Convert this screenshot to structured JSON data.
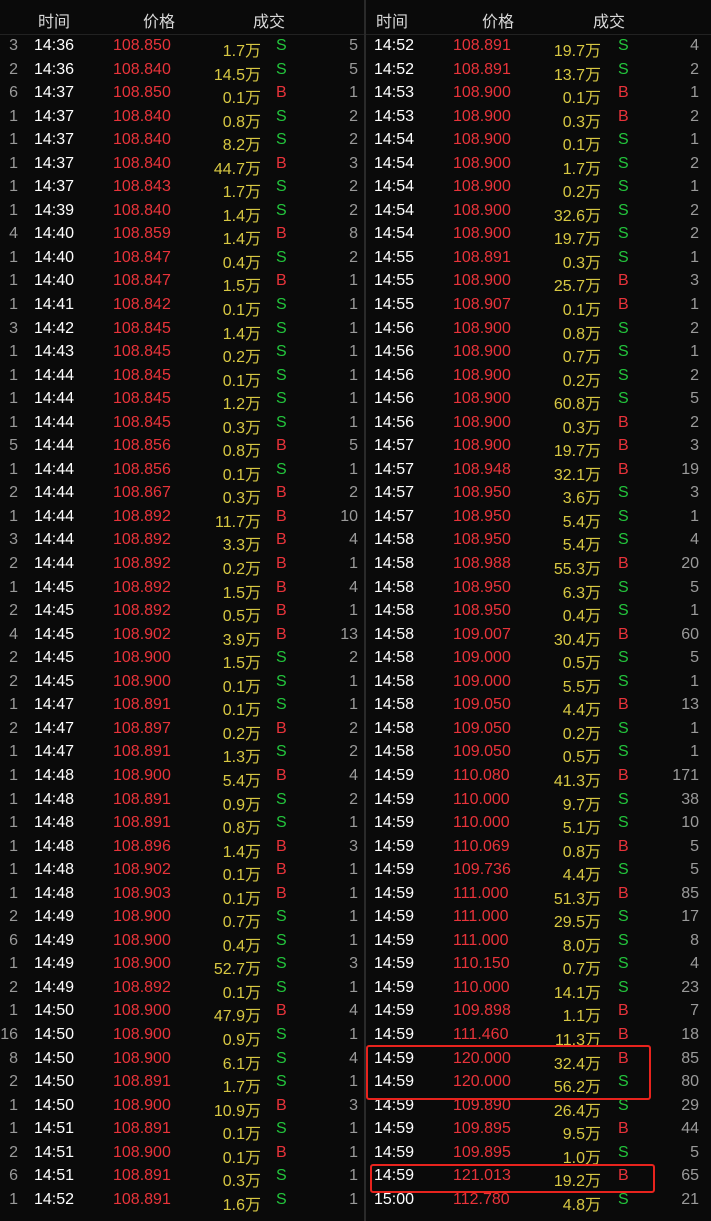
{
  "headers": {
    "time": "时间",
    "price": "价格",
    "volume": "成交"
  },
  "left_rows": [
    [
      "3",
      "14:36",
      "108.850",
      "1.7万",
      "S",
      "5"
    ],
    [
      "2",
      "14:36",
      "108.840",
      "14.5万",
      "S",
      "5"
    ],
    [
      "6",
      "14:37",
      "108.850",
      "0.1万",
      "B",
      "1"
    ],
    [
      "1",
      "14:37",
      "108.840",
      "0.8万",
      "S",
      "2"
    ],
    [
      "1",
      "14:37",
      "108.840",
      "8.2万",
      "S",
      "2"
    ],
    [
      "1",
      "14:37",
      "108.840",
      "44.7万",
      "B",
      "3"
    ],
    [
      "1",
      "14:37",
      "108.843",
      "1.7万",
      "S",
      "2"
    ],
    [
      "1",
      "14:39",
      "108.840",
      "1.4万",
      "S",
      "2"
    ],
    [
      "4",
      "14:40",
      "108.859",
      "1.4万",
      "B",
      "8"
    ],
    [
      "1",
      "14:40",
      "108.847",
      "0.4万",
      "S",
      "2"
    ],
    [
      "1",
      "14:40",
      "108.847",
      "1.5万",
      "B",
      "1"
    ],
    [
      "1",
      "14:41",
      "108.842",
      "0.1万",
      "S",
      "1"
    ],
    [
      "3",
      "14:42",
      "108.845",
      "1.4万",
      "S",
      "1"
    ],
    [
      "1",
      "14:43",
      "108.845",
      "0.2万",
      "S",
      "1"
    ],
    [
      "1",
      "14:44",
      "108.845",
      "0.1万",
      "S",
      "1"
    ],
    [
      "1",
      "14:44",
      "108.845",
      "1.2万",
      "S",
      "1"
    ],
    [
      "1",
      "14:44",
      "108.845",
      "0.3万",
      "S",
      "1"
    ],
    [
      "5",
      "14:44",
      "108.856",
      "0.8万",
      "B",
      "5"
    ],
    [
      "1",
      "14:44",
      "108.856",
      "0.1万",
      "S",
      "1"
    ],
    [
      "2",
      "14:44",
      "108.867",
      "0.3万",
      "B",
      "2"
    ],
    [
      "1",
      "14:44",
      "108.892",
      "11.7万",
      "B",
      "10"
    ],
    [
      "3",
      "14:44",
      "108.892",
      "3.3万",
      "B",
      "4"
    ],
    [
      "2",
      "14:44",
      "108.892",
      "0.2万",
      "B",
      "1"
    ],
    [
      "1",
      "14:45",
      "108.892",
      "1.5万",
      "B",
      "4"
    ],
    [
      "2",
      "14:45",
      "108.892",
      "0.5万",
      "B",
      "1"
    ],
    [
      "4",
      "14:45",
      "108.902",
      "3.9万",
      "B",
      "13"
    ],
    [
      "2",
      "14:45",
      "108.900",
      "1.5万",
      "S",
      "2"
    ],
    [
      "2",
      "14:45",
      "108.900",
      "0.1万",
      "S",
      "1"
    ],
    [
      "1",
      "14:47",
      "108.891",
      "0.1万",
      "S",
      "1"
    ],
    [
      "2",
      "14:47",
      "108.897",
      "0.2万",
      "B",
      "2"
    ],
    [
      "1",
      "14:47",
      "108.891",
      "1.3万",
      "S",
      "2"
    ],
    [
      "1",
      "14:48",
      "108.900",
      "5.4万",
      "B",
      "4"
    ],
    [
      "1",
      "14:48",
      "108.891",
      "0.9万",
      "S",
      "2"
    ],
    [
      "1",
      "14:48",
      "108.891",
      "0.8万",
      "S",
      "1"
    ],
    [
      "1",
      "14:48",
      "108.896",
      "1.4万",
      "B",
      "3"
    ],
    [
      "1",
      "14:48",
      "108.902",
      "0.1万",
      "B",
      "1"
    ],
    [
      "1",
      "14:48",
      "108.903",
      "0.1万",
      "B",
      "1"
    ],
    [
      "2",
      "14:49",
      "108.900",
      "0.7万",
      "S",
      "1"
    ],
    [
      "6",
      "14:49",
      "108.900",
      "0.4万",
      "S",
      "1"
    ],
    [
      "1",
      "14:49",
      "108.900",
      "52.7万",
      "S",
      "3"
    ],
    [
      "2",
      "14:49",
      "108.892",
      "0.1万",
      "S",
      "1"
    ],
    [
      "1",
      "14:50",
      "108.900",
      "47.9万",
      "B",
      "4"
    ],
    [
      "16",
      "14:50",
      "108.900",
      "0.9万",
      "S",
      "1"
    ],
    [
      "8",
      "14:50",
      "108.900",
      "6.1万",
      "S",
      "4"
    ],
    [
      "2",
      "14:50",
      "108.891",
      "1.7万",
      "S",
      "1"
    ],
    [
      "1",
      "14:50",
      "108.900",
      "10.9万",
      "B",
      "3"
    ],
    [
      "1",
      "14:51",
      "108.891",
      "0.1万",
      "S",
      "1"
    ],
    [
      "2",
      "14:51",
      "108.900",
      "0.1万",
      "B",
      "1"
    ],
    [
      "6",
      "14:51",
      "108.891",
      "0.3万",
      "S",
      "1"
    ],
    [
      "1",
      "14:52",
      "108.891",
      "1.6万",
      "S",
      "1"
    ]
  ],
  "right_rows": [
    [
      "14:52",
      "108.891",
      "19.7万",
      "S",
      "4"
    ],
    [
      "14:52",
      "108.891",
      "13.7万",
      "S",
      "2"
    ],
    [
      "14:53",
      "108.900",
      "0.1万",
      "B",
      "1"
    ],
    [
      "14:53",
      "108.900",
      "0.3万",
      "B",
      "2"
    ],
    [
      "14:54",
      "108.900",
      "0.1万",
      "S",
      "1"
    ],
    [
      "14:54",
      "108.900",
      "1.7万",
      "S",
      "2"
    ],
    [
      "14:54",
      "108.900",
      "0.2万",
      "S",
      "1"
    ],
    [
      "14:54",
      "108.900",
      "32.6万",
      "S",
      "2"
    ],
    [
      "14:54",
      "108.900",
      "19.7万",
      "S",
      "2"
    ],
    [
      "14:55",
      "108.891",
      "0.3万",
      "S",
      "1"
    ],
    [
      "14:55",
      "108.900",
      "25.7万",
      "B",
      "3"
    ],
    [
      "14:55",
      "108.907",
      "0.1万",
      "B",
      "1"
    ],
    [
      "14:56",
      "108.900",
      "0.8万",
      "S",
      "2"
    ],
    [
      "14:56",
      "108.900",
      "0.7万",
      "S",
      "1"
    ],
    [
      "14:56",
      "108.900",
      "0.2万",
      "S",
      "2"
    ],
    [
      "14:56",
      "108.900",
      "60.8万",
      "S",
      "5"
    ],
    [
      "14:56",
      "108.900",
      "0.3万",
      "B",
      "2"
    ],
    [
      "14:57",
      "108.900",
      "19.7万",
      "B",
      "3"
    ],
    [
      "14:57",
      "108.948",
      "32.1万",
      "B",
      "19"
    ],
    [
      "14:57",
      "108.950",
      "3.6万",
      "S",
      "3"
    ],
    [
      "14:57",
      "108.950",
      "5.4万",
      "S",
      "1"
    ],
    [
      "14:58",
      "108.950",
      "5.4万",
      "S",
      "4"
    ],
    [
      "14:58",
      "108.988",
      "55.3万",
      "B",
      "20"
    ],
    [
      "14:58",
      "108.950",
      "6.3万",
      "S",
      "5"
    ],
    [
      "14:58",
      "108.950",
      "0.4万",
      "S",
      "1"
    ],
    [
      "14:58",
      "109.007",
      "30.4万",
      "B",
      "60"
    ],
    [
      "14:58",
      "109.000",
      "0.5万",
      "S",
      "5"
    ],
    [
      "14:58",
      "109.000",
      "5.5万",
      "S",
      "1"
    ],
    [
      "14:58",
      "109.050",
      "4.4万",
      "B",
      "13"
    ],
    [
      "14:58",
      "109.050",
      "0.2万",
      "S",
      "1"
    ],
    [
      "14:58",
      "109.050",
      "0.5万",
      "S",
      "1"
    ],
    [
      "14:59",
      "110.080",
      "41.3万",
      "B",
      "171"
    ],
    [
      "14:59",
      "110.000",
      "9.7万",
      "S",
      "38"
    ],
    [
      "14:59",
      "110.000",
      "5.1万",
      "S",
      "10"
    ],
    [
      "14:59",
      "110.069",
      "0.8万",
      "B",
      "5"
    ],
    [
      "14:59",
      "109.736",
      "4.4万",
      "S",
      "5"
    ],
    [
      "14:59",
      "111.000",
      "51.3万",
      "B",
      "85"
    ],
    [
      "14:59",
      "111.000",
      "29.5万",
      "S",
      "17"
    ],
    [
      "14:59",
      "111.000",
      "8.0万",
      "S",
      "8"
    ],
    [
      "14:59",
      "110.150",
      "0.7万",
      "S",
      "4"
    ],
    [
      "14:59",
      "110.000",
      "14.1万",
      "S",
      "23"
    ],
    [
      "14:59",
      "109.898",
      "1.1万",
      "B",
      "7"
    ],
    [
      "14:59",
      "111.460",
      "11.3万",
      "B",
      "18"
    ],
    [
      "14:59",
      "120.000",
      "32.4万",
      "B",
      "85"
    ],
    [
      "14:59",
      "120.000",
      "56.2万",
      "S",
      "80"
    ],
    [
      "14:59",
      "109.890",
      "26.4万",
      "S",
      "29"
    ],
    [
      "14:59",
      "109.895",
      "9.5万",
      "B",
      "44"
    ],
    [
      "14:59",
      "109.895",
      "1.0万",
      "S",
      "5"
    ],
    [
      "14:59",
      "121.013",
      "19.2万",
      "B",
      "65"
    ],
    [
      "15:00",
      "112.780",
      "4.8万",
      "S",
      "21"
    ]
  ],
  "colors": {
    "background": "#0a0a0a",
    "price": "#e8333a",
    "volume": "#d8c843",
    "buy": "#e8333a",
    "sell": "#23c43c",
    "highlight": "#e8231d"
  }
}
